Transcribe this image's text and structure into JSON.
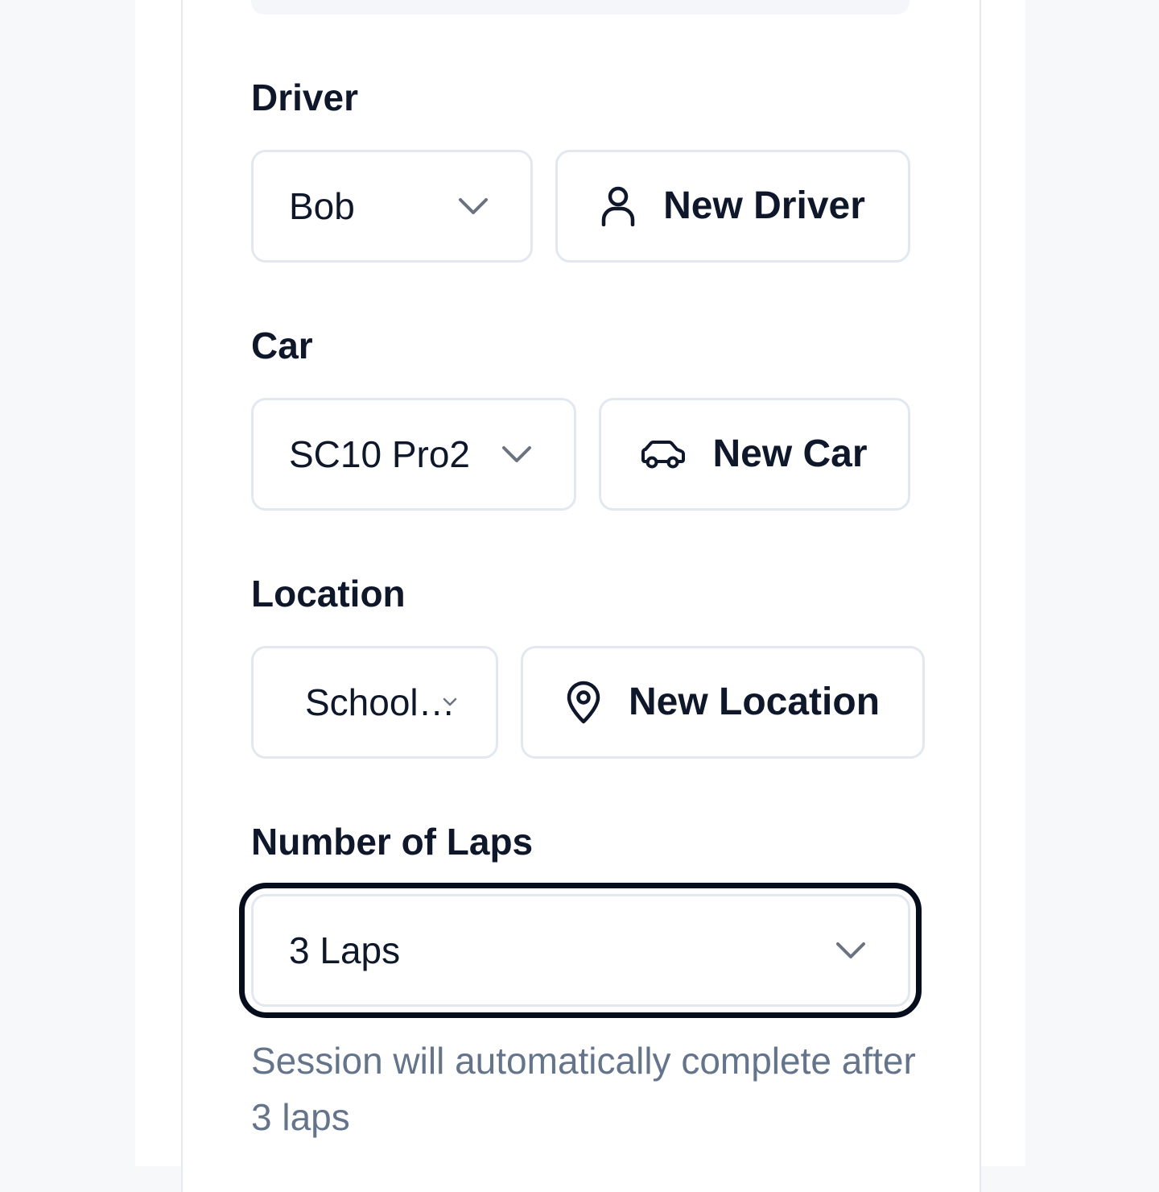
{
  "driver": {
    "label": "Driver",
    "selected": "Bob",
    "new_button": "New Driver",
    "new_icon": "user-icon"
  },
  "car": {
    "label": "Car",
    "selected": "SC10 Pro2",
    "new_button": "New Car",
    "new_icon": "car-icon"
  },
  "location": {
    "label": "Location",
    "selected": "School…",
    "new_button": "New Location",
    "new_icon": "map-pin-icon"
  },
  "laps": {
    "label": "Number of Laps",
    "selected": "3 Laps",
    "helper": "Session will automatically complete after 3 laps"
  },
  "colors": {
    "text": "#0f172a",
    "muted": "#64748b",
    "border": "#e2e8f0",
    "focus": "#060d1c"
  }
}
